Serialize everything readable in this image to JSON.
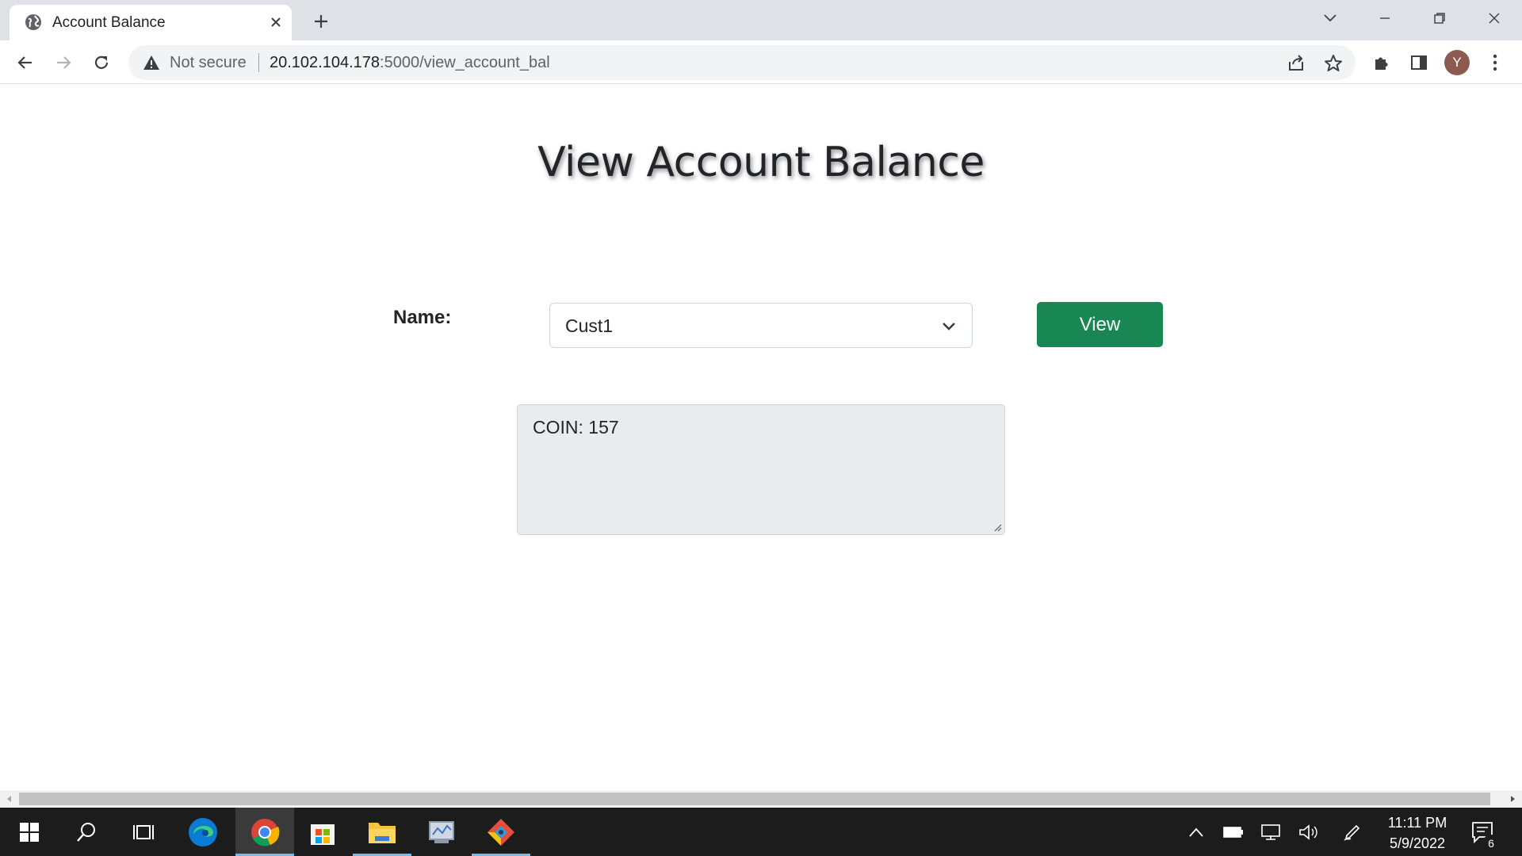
{
  "browser": {
    "tab_title": "Account Balance",
    "tab_favicon": "globe-icon",
    "address": {
      "security_label": "Not secure",
      "host": "20.102.104.178",
      "path": ":5000/view_account_bal"
    },
    "profile_initial": "Y"
  },
  "page": {
    "title": "View Account Balance",
    "name_label": "Name:",
    "name_select": {
      "selected": "Cust1"
    },
    "view_button": "View",
    "result_text": "COIN: 157"
  },
  "taskbar": {
    "apps": [
      "windows-start",
      "search",
      "task-view",
      "edge",
      "chrome",
      "microsoft-store",
      "file-explorer",
      "control-panel",
      "git"
    ],
    "clock_time": "11:11 PM",
    "clock_date": "5/9/2022",
    "notification_count": "6"
  },
  "colors": {
    "accent_button": "#198754",
    "tabstrip": "#dee1e6",
    "taskbar": "#1c1c1c"
  }
}
